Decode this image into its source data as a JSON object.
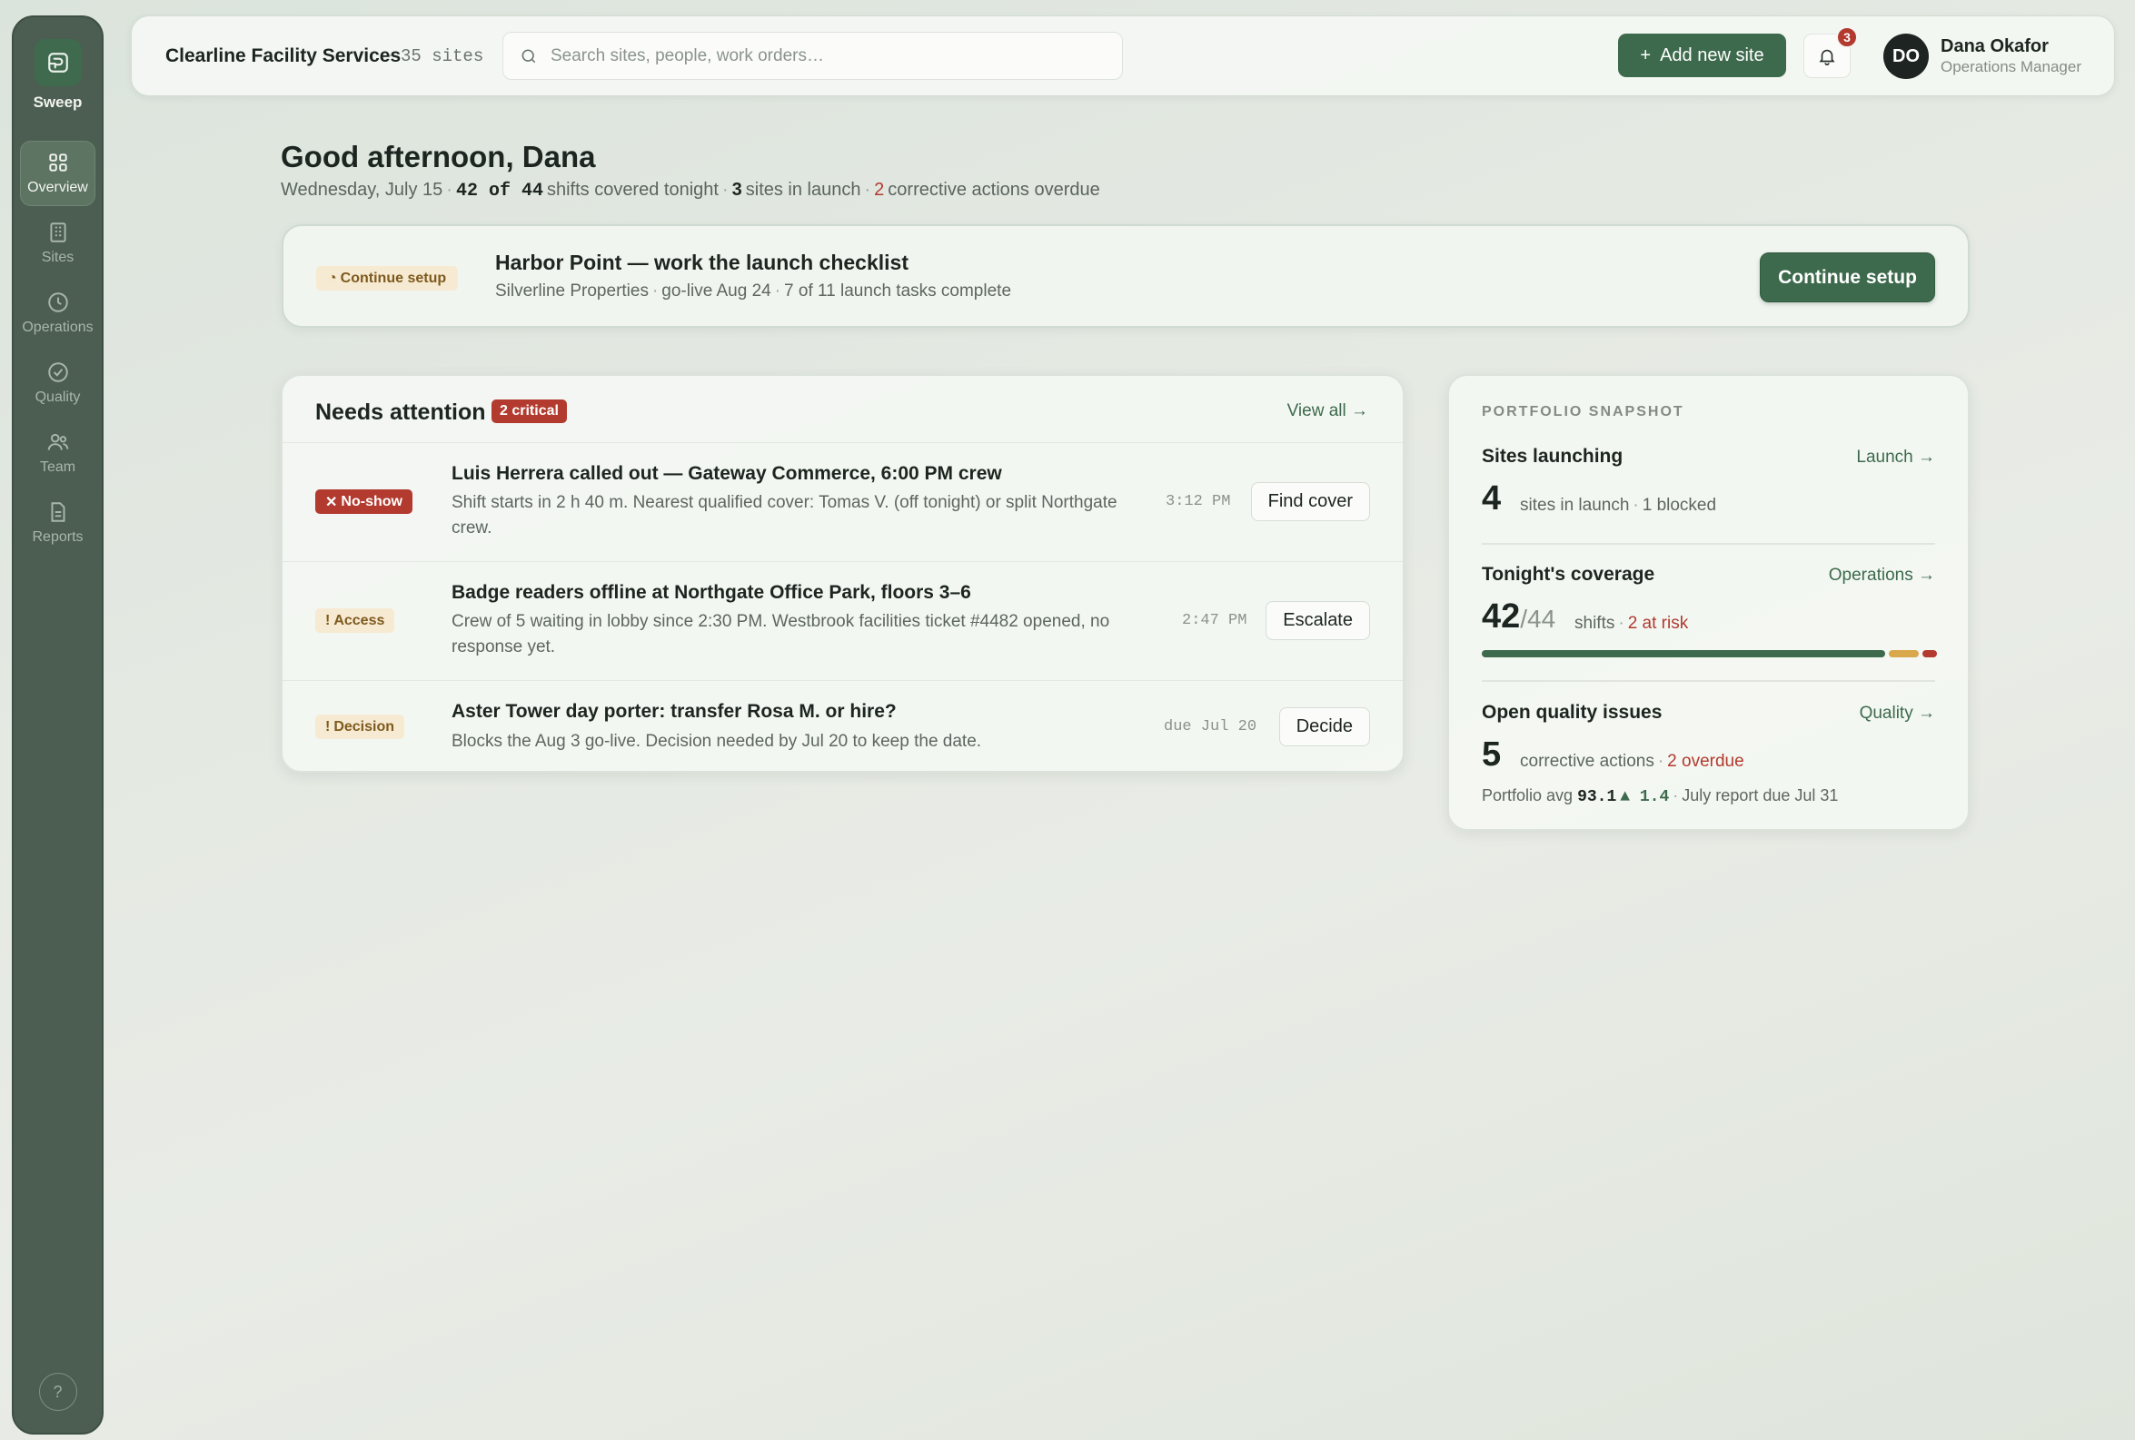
{
  "app": {
    "name": "Sweep"
  },
  "colors": {
    "accent": "#3d6a4c",
    "danger": "#b23a2e",
    "warning": "#d9a84a",
    "sidebar": "#4c5e51"
  },
  "sidebar": {
    "items": [
      {
        "label": "Overview",
        "icon": "overview-grid-icon",
        "active": true
      },
      {
        "label": "Sites",
        "icon": "sites-building-icon",
        "active": false
      },
      {
        "label": "Operations",
        "icon": "operations-clock-icon",
        "active": false
      },
      {
        "label": "Quality",
        "icon": "quality-check-icon",
        "active": false
      },
      {
        "label": "Team",
        "icon": "team-people-icon",
        "active": false
      },
      {
        "label": "Reports",
        "icon": "reports-document-icon",
        "active": false
      }
    ],
    "help_label": "?"
  },
  "header": {
    "org_name": "Clearline Facility Services",
    "site_count": "35 sites",
    "search_placeholder": "Search sites, people, work orders…",
    "add_button": "Add new site",
    "add_icon": "+",
    "notification_count": "3",
    "user": {
      "initials": "DO",
      "name": "Dana Okafor",
      "role": "Operations Manager"
    }
  },
  "greeting": {
    "title": "Good afternoon, Dana",
    "date": "Wednesday, July 15",
    "shifts_covered": "42 of 44",
    "shifts_text": "shifts covered tonight",
    "sites_launch_count": "3",
    "sites_launch_text": "sites in launch",
    "overdue_count": "2",
    "overdue_text": "corrective actions overdue"
  },
  "setup": {
    "tag": "Continue setup",
    "tag_icon": "◔",
    "title": "Harbor Point — work the launch checklist",
    "client": "Silverline Properties",
    "golive": "go-live Aug 24",
    "progress": "7 of 11 launch tasks complete",
    "button": "Continue setup"
  },
  "attention": {
    "title": "Needs attention",
    "critical_badge": "2 critical",
    "view_all": "View all →",
    "rows": [
      {
        "tag": "No-show",
        "tag_icon": "✕",
        "title": "Luis Herrera called out — Gateway Commerce, 6:00 PM crew",
        "desc": "Shift starts in 2 h 40 m. Nearest qualified cover: Tomas V. (off tonight) or split Northgate crew.",
        "time": "3:12 PM",
        "action": "Find cover"
      },
      {
        "tag": "Access",
        "tag_icon": "!",
        "title": "Badge readers offline at Northgate Office Park, floors 3–6",
        "desc": "Crew of 5 waiting in lobby since 2:30 PM. Westbrook facilities ticket #4482 opened, no response yet.",
        "time": "2:47 PM",
        "action": "Escalate"
      },
      {
        "tag": "Decision",
        "tag_icon": "!",
        "title": "Aster Tower day porter: transfer Rosa M. or hire?",
        "desc": "Blocks the Aug 3 go-live. Decision needed by Jul 20 to keep the date.",
        "time": "due Jul 20",
        "action": "Decide"
      }
    ]
  },
  "portfolio": {
    "label": "PORTFOLIO SNAPSHOT",
    "launching": {
      "title": "Sites launching",
      "link": "Launch →",
      "value": "4",
      "note": "sites in launch",
      "blocked": "1 blocked"
    },
    "coverage": {
      "title": "Tonight's coverage",
      "link": "Operations →",
      "value": "42",
      "denominator": "/44",
      "note": "shifts",
      "at_risk": "2 at risk",
      "covered_fraction": 0.905,
      "at_risk_fraction": 0.067,
      "uncovered_fraction": 0.033
    },
    "quality": {
      "title": "Open quality issues",
      "link": "Quality →",
      "value": "5",
      "note": "corrective actions",
      "overdue": "2 overdue",
      "avg_label": "Portfolio avg",
      "avg_value": "93.1",
      "delta": "▲ 1.4",
      "report": "July report due Jul 31"
    }
  }
}
